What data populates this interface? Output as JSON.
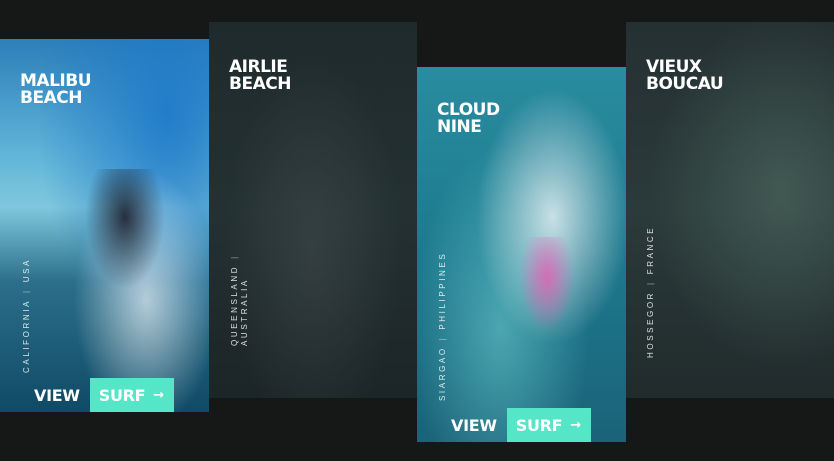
{
  "cards": [
    {
      "title_line1": "MALIBU",
      "title_line2": "BEACH",
      "location_a": "CALIFORNIA",
      "location_b": "USA",
      "view_label": "VIEW",
      "surf_label": "SURF",
      "accent": "#55e6c8"
    },
    {
      "title_line1": "AIRLIE",
      "title_line2": "BEACH",
      "location_a": "QUEENSLAND",
      "location_b": "AUSTRALIA"
    },
    {
      "title_line1": "CLOUD",
      "title_line2": "NINE",
      "location_a": "SIARGAO",
      "location_b": "PHILIPPINES",
      "view_label": "VIEW",
      "surf_label": "SURF",
      "accent": "#55e6c8"
    },
    {
      "title_line1": "VIEUX",
      "title_line2": "BOUCAU",
      "location_a": "HOSSEGOR",
      "location_b": "FRANCE"
    }
  ],
  "icons": {
    "arrow": "arrow-right-icon"
  },
  "colors": {
    "background": "#161818",
    "accent": "#55e6c8",
    "text": "#ffffff"
  }
}
